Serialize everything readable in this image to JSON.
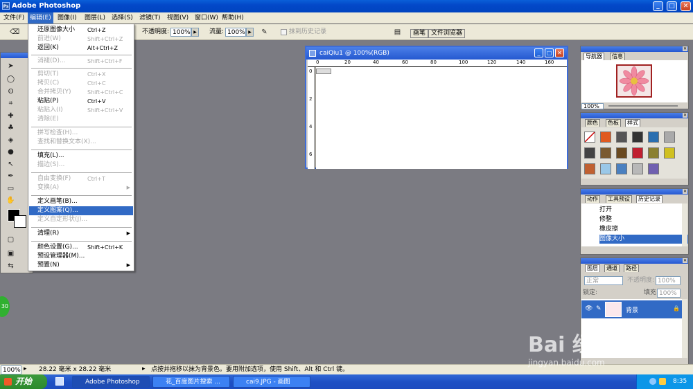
{
  "app": {
    "title": "Adobe Photoshop"
  },
  "menu": [
    {
      "label": "文件(F)"
    },
    {
      "label": "编辑(E)"
    },
    {
      "label": "图像(I)"
    },
    {
      "label": "图层(L)"
    },
    {
      "label": "选择(S)"
    },
    {
      "label": "滤镜(T)"
    },
    {
      "label": "视图(V)"
    },
    {
      "label": "窗口(W)"
    },
    {
      "label": "帮助(H)"
    }
  ],
  "options": {
    "opacity_label": "不透明度:",
    "opacity_value": "100%",
    "flow_label": "流量:",
    "flow_value": "100%",
    "erase_history_label": "抹到历史记录",
    "tab_brushes": "画笔",
    "tab_file_browser": "文件浏览器"
  },
  "edit_menu": {
    "items": [
      {
        "label": "还原图像大小",
        "shortcut": "Ctrl+Z"
      },
      {
        "label": "前进(W)",
        "shortcut": "Shift+Ctrl+Z"
      },
      {
        "label": "返回(K)",
        "shortcut": "Alt+Ctrl+Z"
      },
      {
        "label": "消褪(D)...",
        "shortcut": "Shift+Ctrl+F"
      },
      {
        "label": "剪切(T)",
        "shortcut": "Ctrl+X"
      },
      {
        "label": "拷贝(C)",
        "shortcut": "Ctrl+C"
      },
      {
        "label": "合并拷贝(Y)",
        "shortcut": "Shift+Ctrl+C"
      },
      {
        "label": "粘贴(P)",
        "shortcut": "Ctrl+V"
      },
      {
        "label": "粘贴入(I)",
        "shortcut": "Shift+Ctrl+V"
      },
      {
        "label": "清除(E)",
        "shortcut": ""
      },
      {
        "label": "拼写检查(H)...",
        "shortcut": ""
      },
      {
        "label": "查找和替换文本(X)...",
        "shortcut": ""
      },
      {
        "label": "填充(L)...",
        "shortcut": ""
      },
      {
        "label": "描边(S)...",
        "shortcut": ""
      },
      {
        "label": "自由变换(F)",
        "shortcut": "Ctrl+T"
      },
      {
        "label": "变换(A)",
        "shortcut": ""
      },
      {
        "label": "定义画笔(B)...",
        "shortcut": ""
      },
      {
        "label": "定义图案(Q)...",
        "shortcut": ""
      },
      {
        "label": "定义自定形状(J)...",
        "shortcut": ""
      },
      {
        "label": "清理(R)",
        "shortcut": ""
      },
      {
        "label": "颜色设置(G)...",
        "shortcut": "Shift+Ctrl+K"
      },
      {
        "label": "预设管理器(M)...",
        "shortcut": ""
      },
      {
        "label": "预置(N)",
        "shortcut": ""
      }
    ]
  },
  "document": {
    "title": "caiQiu1 @ 100%(RGB)",
    "ruler_labels": [
      "0",
      "20",
      "40",
      "60",
      "80",
      "100",
      "120",
      "140",
      "160"
    ],
    "vruler_labels": [
      "0",
      "2",
      "4",
      "6"
    ]
  },
  "navigator": {
    "tab1": "导航器",
    "tab2": "信息",
    "zoom": "100%"
  },
  "swatches": {
    "tab1": "颜色",
    "tab2": "色板",
    "tab3": "样式"
  },
  "history": {
    "tab1": "动作",
    "tab2": "工具预设",
    "tab3": "历史记录",
    "items": [
      {
        "label": "打开"
      },
      {
        "label": "修整"
      },
      {
        "label": "橡皮擦"
      },
      {
        "label": "图像大小"
      }
    ]
  },
  "layers": {
    "tab1": "图层",
    "tab2": "通道",
    "tab3": "路径",
    "blend_mode": "正常",
    "opacity_label": "不透明度:",
    "opacity_value": "100%",
    "lock_label": "锁定:",
    "fill_label": "填充:",
    "fill_value": "100%",
    "layer_name": "背景"
  },
  "status": {
    "zoom": "100%",
    "doc_size": "28.22 毫米 x 28.22 毫米",
    "hint": "点按并拖移以抹为背景色。要用附加选项，使用 Shift、Alt 和 Ctrl 键。"
  },
  "taskbar": {
    "start": "开始",
    "tasks": [
      {
        "label": "Adobe Photoshop"
      },
      {
        "label": "花_百度图片搜索 ..."
      },
      {
        "label": "cai9.JPG - 画图"
      }
    ],
    "clock": "8:35",
    "badge": "30"
  },
  "watermark": {
    "text": "Bai 经验",
    "url": "jingyan.baidu.com"
  }
}
